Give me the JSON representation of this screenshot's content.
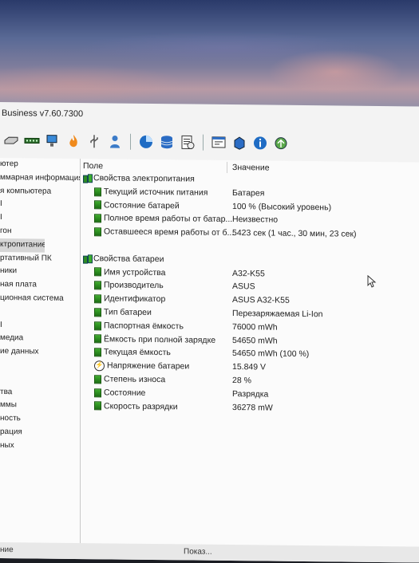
{
  "window": {
    "title": "Business v7.60.7300"
  },
  "toolbar": {
    "icons": [
      "drive-icon",
      "memory-icon",
      "network-icon",
      "flame-icon",
      "usb-icon",
      "user-icon",
      "chart-icon",
      "database-icon",
      "report-icon",
      "window-icon",
      "download-icon",
      "info-icon",
      "update-icon"
    ]
  },
  "sidebar": {
    "items": [
      {
        "label": "ютер"
      },
      {
        "label": "ммарная информация"
      },
      {
        "label": "я компьютера"
      },
      {
        "label": "I"
      },
      {
        "label": "I"
      },
      {
        "label": "гон"
      },
      {
        "label": "ктропитание",
        "selected": true
      },
      {
        "label": "ртативный ПК"
      },
      {
        "label": "ники"
      },
      {
        "label": "ная плата"
      },
      {
        "label": "ционная система"
      },
      {
        "label": ""
      },
      {
        "label": "I"
      },
      {
        "label": "медиа"
      },
      {
        "label": "ие данных"
      },
      {
        "label": ""
      },
      {
        "label": ""
      },
      {
        "label": "тва"
      },
      {
        "label": "ммы"
      },
      {
        "label": "ность"
      },
      {
        "label": "рация"
      },
      {
        "label": "ных"
      }
    ]
  },
  "columns": {
    "field": "Поле",
    "value": "Значение"
  },
  "groups": [
    {
      "title": "Свойства электропитания",
      "rows": [
        {
          "field": "Текущий источник питания",
          "value": "Батарея",
          "icon": "battery-icon"
        },
        {
          "field": "Состояние батарей",
          "value": "100 % (Высокий уровень)",
          "icon": "battery-icon"
        },
        {
          "field": "Полное время работы от батар...",
          "value": "Неизвестно",
          "icon": "battery-icon"
        },
        {
          "field": "Оставшееся время работы от б...",
          "value": "5423 сек (1 час., 30 мин, 23 сек)",
          "icon": "battery-icon"
        }
      ]
    },
    {
      "title": "Свойства батареи",
      "rows": [
        {
          "field": "Имя устройства",
          "value": "A32-K55",
          "icon": "battery-icon"
        },
        {
          "field": "Производитель",
          "value": "ASUS",
          "icon": "battery-icon"
        },
        {
          "field": "Идентификатор",
          "value": "ASUS A32-K55",
          "icon": "battery-icon"
        },
        {
          "field": "Тип батареи",
          "value": "Перезаряжаемая Li-Ion",
          "icon": "battery-icon"
        },
        {
          "field": "Паспортная ёмкость",
          "value": "76000 mWh",
          "icon": "battery-icon"
        },
        {
          "field": "Ёмкость при полной зарядке",
          "value": "54650 mWh",
          "icon": "battery-icon"
        },
        {
          "field": "Текущая ёмкость",
          "value": "54650 mWh  (100 %)",
          "icon": "battery-icon"
        },
        {
          "field": "Напряжение батареи",
          "value": "15.849 V",
          "icon": "voltage-icon"
        },
        {
          "field": "Степень износа",
          "value": "28 %",
          "icon": "battery-icon"
        },
        {
          "field": "Состояние",
          "value": "Разрядка",
          "icon": "battery-icon"
        },
        {
          "field": "Скорость разрядки",
          "value": "36278 mW",
          "icon": "battery-icon"
        }
      ]
    }
  ],
  "statusbar": {
    "left": "ние",
    "right": "Показ..."
  }
}
